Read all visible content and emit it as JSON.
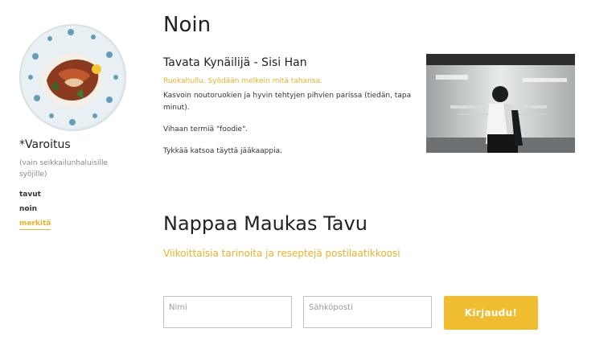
{
  "sidebar": {
    "title": "*Varoitus",
    "description": "(vain seikkailunhaluisille syöjille)",
    "nav": [
      {
        "label": "tavut"
      },
      {
        "label": "noin"
      },
      {
        "label": "merkitä"
      }
    ]
  },
  "page": {
    "title": "Noin"
  },
  "about": {
    "heading": "Tavata Kynäilijä - Sisi Han",
    "tagline": "Ruokahullu. Syödään melkein mitä tahansa.",
    "paragraphs": [
      "Kasvoin noutoruokien ja hyvin tehtyjen pihvien parissa (tiedän, tapa minut).",
      "Vihaan termiä \"foodie\".",
      "Tykkää katsoa täyttä jääkaappia."
    ]
  },
  "newsletter": {
    "title": "Nappaa Maukas Tavu",
    "subtitle": "Viikoittaisia tarinoita ja reseptejä postilaatikkoosi",
    "name_placeholder": "Nimi",
    "email_placeholder": "Sähköposti",
    "submit_label": "Kirjaudu!"
  },
  "colors": {
    "accent": "#f0bd30",
    "text": "#222222"
  }
}
